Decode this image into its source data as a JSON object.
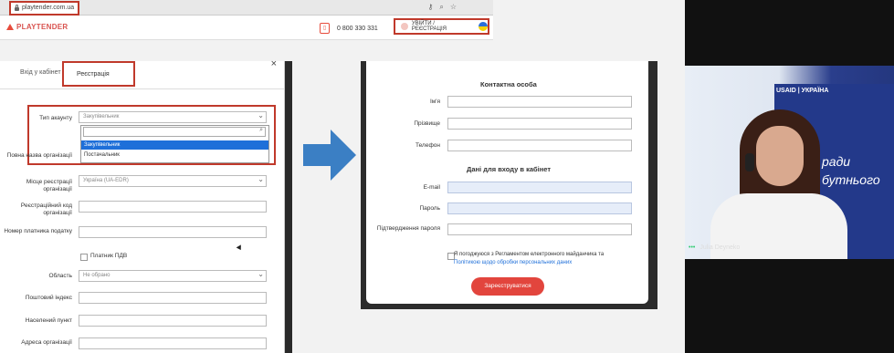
{
  "browser": {
    "url": "playtender.com.ua",
    "icons": [
      "key-icon",
      "search-icon",
      "star-icon"
    ]
  },
  "site": {
    "logo": "PLAYTENDER",
    "phone": "0 800 330 331",
    "login_label": "УВІЙТИ / РЕЄСТРАЦІЯ"
  },
  "modal": {
    "tabs": [
      "Вхід у кабінет",
      "Реєстрація"
    ],
    "close": "×",
    "fields": {
      "account_type_label": "Тип акаунту",
      "account_type_value": "Закупівельник",
      "full_name_label": "Повна назва організації",
      "reg_place_label": "Місце реєстрації організації",
      "reg_place_value": "Україна (UA-EDR)",
      "reg_code_label": "Реєстраційний код організації",
      "tax_number_label": "Номер платника податку",
      "vat_label": "Платник ПДВ",
      "region_label": "Область",
      "region_value": "Не обрано",
      "postal_label": "Поштовий індекс",
      "city_label": "Населений пункт",
      "address_label": "Адреса організації"
    },
    "dropdown_options": [
      "Закупівельник",
      "Постачальник"
    ]
  },
  "right_form": {
    "contact_heading": "Контактна особа",
    "name_label": "Ім'я",
    "surname_label": "Прізвище",
    "phone_label": "Телефон",
    "login_heading": "Дані для входу в кабінет",
    "email_label": "E-mail",
    "password_label": "Пароль",
    "confirm_label": "Підтвердження пароля",
    "agree_text": "Я погоджуюся з Регламентом електронного майданчика та",
    "agree_link": "Політикою щодо обробки персональних даних",
    "register_button": "Зареєструватися"
  },
  "video": {
    "participant_name": "Julia Deyneko",
    "banner_logo": "USAID | УКРАЇНА",
    "banner_text": "ради\nбутнього"
  },
  "colors": {
    "accent": "#e2453d",
    "highlight_box": "#c0392b",
    "dropdown_selected": "#1e6fd9"
  }
}
